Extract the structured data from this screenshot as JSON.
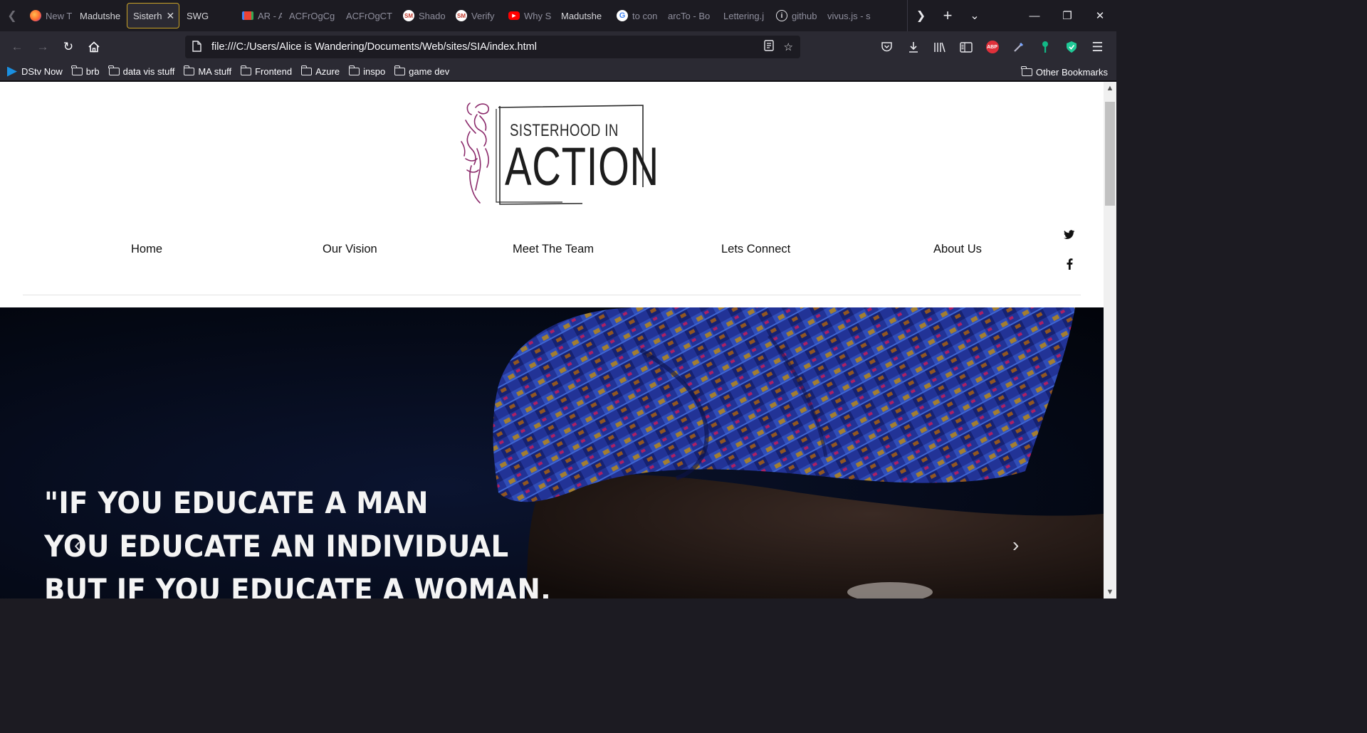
{
  "browser": {
    "tabs": [
      {
        "label": "New T",
        "favicon": "firefox-icon",
        "fade": true
      },
      {
        "label": "Madutshe",
        "favicon": "none",
        "fade": false
      },
      {
        "label": "Sisterh",
        "favicon": "none",
        "fade": false,
        "active": true
      },
      {
        "label": "SWG",
        "favicon": "none",
        "fade": false
      },
      {
        "label": "AR - A",
        "favicon": "gmail-icon",
        "fade": true
      },
      {
        "label": "ACFrOgCg",
        "favicon": "none",
        "fade": true
      },
      {
        "label": "ACFrOgCT",
        "favicon": "none",
        "fade": true
      },
      {
        "label": "Shado",
        "favicon": "sm-icon",
        "fade": true
      },
      {
        "label": "Verify",
        "favicon": "sm-icon",
        "fade": true
      },
      {
        "label": "Why S",
        "favicon": "youtube-icon",
        "fade": true
      },
      {
        "label": "Madutshe",
        "favicon": "none",
        "fade": false
      },
      {
        "label": "to con",
        "favicon": "google-icon",
        "fade": true
      },
      {
        "label": "arcTo - Bo",
        "favicon": "none",
        "fade": true
      },
      {
        "label": "Lettering.j",
        "favicon": "none",
        "fade": true
      },
      {
        "label": "github",
        "favicon": "info-icon",
        "fade": true
      },
      {
        "label": "vivus.js - s",
        "favicon": "none",
        "fade": true
      }
    ],
    "url": "file:///C:/Users/Alice is Wandering/Documents/Web/sites/SIA/index.html",
    "bookmarks": [
      {
        "label": "DStv Now",
        "icon": "dstv-icon"
      },
      {
        "label": "brb",
        "icon": "folder-icon"
      },
      {
        "label": "data vis stuff",
        "icon": "folder-icon"
      },
      {
        "label": "MA stuff",
        "icon": "folder-icon"
      },
      {
        "label": "Frontend",
        "icon": "folder-icon"
      },
      {
        "label": "Azure",
        "icon": "folder-icon"
      },
      {
        "label": "inspo",
        "icon": "folder-icon"
      },
      {
        "label": "game dev",
        "icon": "folder-icon"
      }
    ],
    "other_bookmarks": "Other Bookmarks",
    "abp_label": "ABP",
    "colors": {
      "chrome_dark": "#1c1b22",
      "chrome": "#2b2a33",
      "active_tab_border": "#c9a227"
    }
  },
  "site": {
    "logo": {
      "line1": "SISTERHOOD IN",
      "line2": "ACTION",
      "figure_color": "#8b2a6b"
    },
    "nav": [
      "Home",
      "Our Vision",
      "Meet The Team",
      "Lets Connect",
      "About Us"
    ],
    "social": [
      "twitter-icon",
      "facebook-icon"
    ],
    "hero": {
      "quote_line1": "\"IF YOU EDUCATE A MAN",
      "quote_line2": "YOU EDUCATE AN INDIVIDUAL",
      "quote_line3": "BUT IF YOU EDUCATE A WOMAN,",
      "prev": "‹",
      "next": "›"
    }
  }
}
